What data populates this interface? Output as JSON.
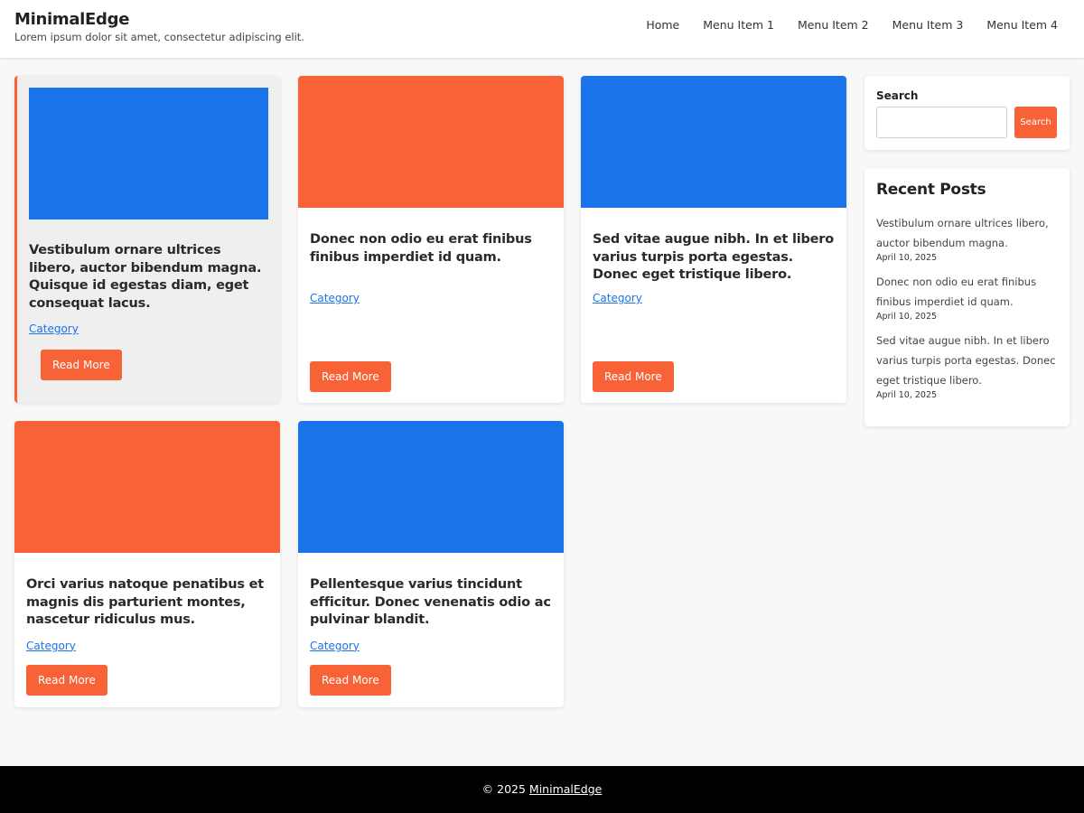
{
  "site": {
    "title": "MinimalEdge",
    "description": "Lorem ipsum dolor sit amet, consectetur adipiscing elit."
  },
  "nav": {
    "items": [
      "Home",
      "Menu Item 1",
      "Menu Item 2",
      "Menu Item 3",
      "Menu Item 4"
    ]
  },
  "colors": {
    "accent": "#f76237",
    "blue": "#1a73e8",
    "footer_bg": "#000000"
  },
  "posts": [
    {
      "title": "Vestibulum ornare ultrices libero, auctor bibendum magna. Quisque id egestas diam, eget consequat lacus.",
      "category": "Category",
      "read_more": "Read More",
      "thumb_color": "#1a73e8"
    },
    {
      "title": "Donec non odio eu erat finibus finibus imperdiet id quam.",
      "category": "Category",
      "read_more": "Read More",
      "thumb_color": "#f76237"
    },
    {
      "title": "Sed vitae augue nibh. In et libero varius turpis porta egestas. Donec eget tristique libero.",
      "category": "Category",
      "read_more": "Read More",
      "thumb_color": "#1a73e8"
    },
    {
      "title": "Orci varius natoque penatibus et magnis dis parturient montes, nascetur ridiculus mus.",
      "category": "Category",
      "read_more": "Read More",
      "thumb_color": "#f76237"
    },
    {
      "title": "Pellentesque varius tincidunt efficitur. Donec venenatis odio ac pulvinar blandit.",
      "category": "Category",
      "read_more": "Read More",
      "thumb_color": "#1a73e8"
    }
  ],
  "sidebar": {
    "search": {
      "label": "Search",
      "button": "Search",
      "value": "",
      "placeholder": ""
    },
    "recent": {
      "title": "Recent Posts",
      "items": [
        {
          "title": "Vestibulum ornare ultrices libero, auctor bibendum magna.",
          "date": "April 10, 2025"
        },
        {
          "title": "Donec non odio eu erat finibus finibus imperdiet id quam.",
          "date": "April 10, 2025"
        },
        {
          "title": "Sed vitae augue nibh. In et libero varius turpis porta egestas. Donec eget tristique libero.",
          "date": "April 10, 2025"
        }
      ]
    }
  },
  "footer": {
    "prefix": "© 2025",
    "link": "MinimalEdge"
  }
}
